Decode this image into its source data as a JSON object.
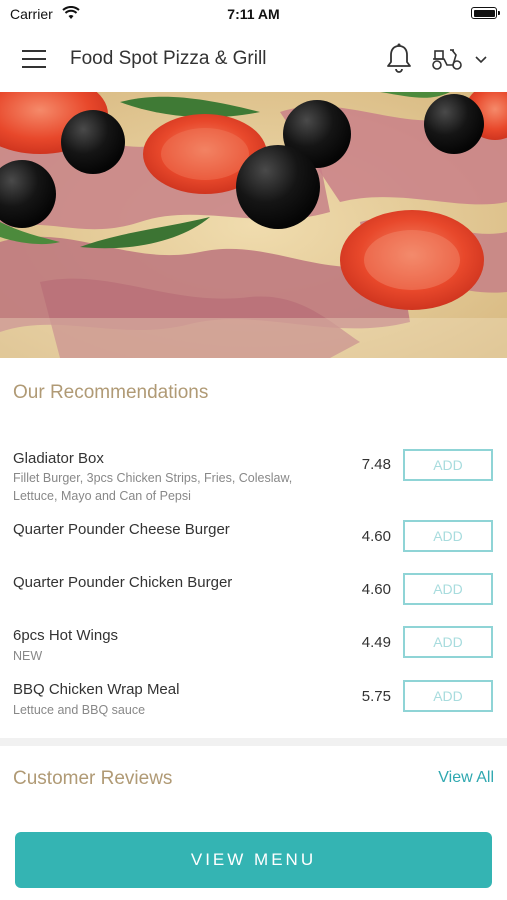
{
  "status_bar": {
    "carrier": "Carrier",
    "time": "7:11 AM"
  },
  "header": {
    "title": "Food Spot Pizza & Grill",
    "icons": [
      "menu-icon",
      "bell-icon",
      "delivery-scooter-icon",
      "chevron-down-icon"
    ]
  },
  "hero": {
    "image": "pizza with olives, tomato slices and prosciutto"
  },
  "recommendations": {
    "title": "Our Recommendations",
    "add_label": "ADD",
    "items": [
      {
        "name": "Gladiator Box",
        "desc_line1": "Fillet Burger, 3pcs Chicken Strips, Fries, Coleslaw,",
        "desc_line2": "Lettuce, Mayo and Can of Pepsi",
        "price": "7.48"
      },
      {
        "name": "Quarter Pounder Cheese Burger",
        "desc_line1": "",
        "desc_line2": "",
        "price": "4.60"
      },
      {
        "name": "Quarter Pounder Chicken Burger",
        "desc_line1": "",
        "desc_line2": "",
        "price": "4.60"
      },
      {
        "name": "6pcs Hot Wings",
        "desc_line1": "NEW",
        "desc_line2": "",
        "price": "4.49"
      },
      {
        "name": "BBQ Chicken Wrap Meal",
        "desc_line1": "Lettuce and BBQ sauce",
        "desc_line2": "",
        "price": "5.75"
      }
    ]
  },
  "reviews": {
    "title": "Customer Reviews",
    "view_all": "View All"
  },
  "footer": {
    "view_menu": "VIEW MENU"
  },
  "colors": {
    "accent": "#34b4b3",
    "section_title": "#b09a75",
    "add_border": "#8fd4d6"
  }
}
